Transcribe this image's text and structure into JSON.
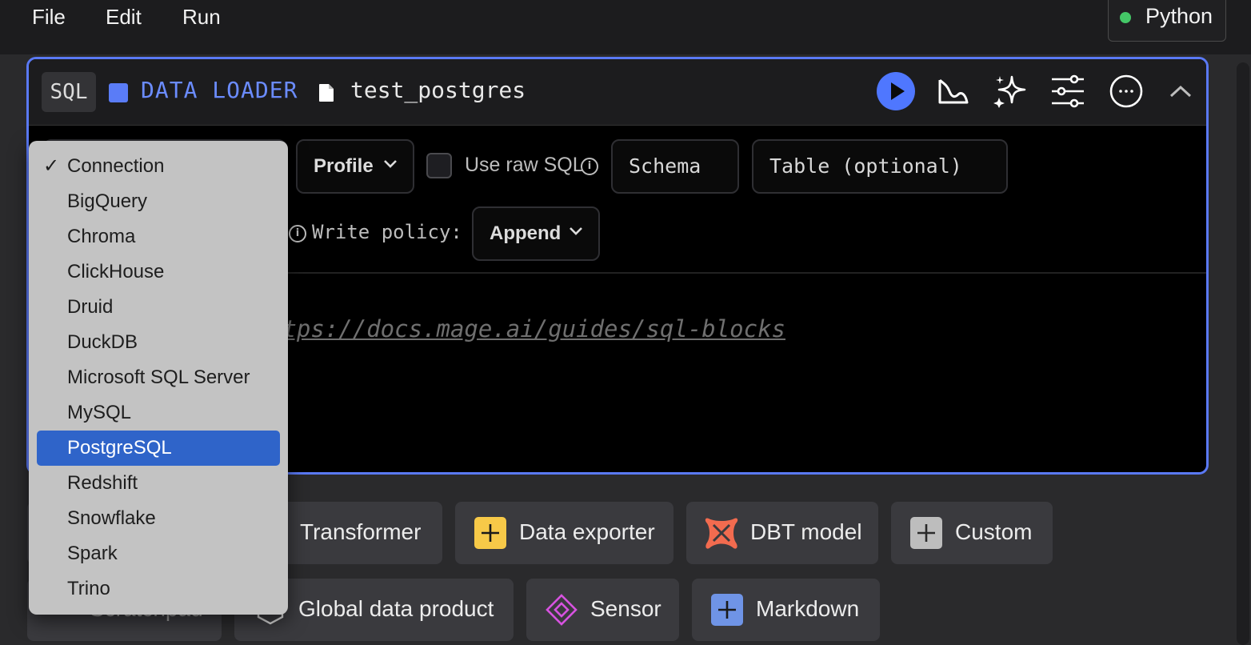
{
  "menu": {
    "items": [
      "File",
      "Edit",
      "Run"
    ]
  },
  "kernel": {
    "label": "Python",
    "status_color": "#44c767"
  },
  "block": {
    "badge": "SQL",
    "type_label": "DATA LOADER",
    "type_color": "#5a7cf7",
    "file_name": "test_postgres",
    "config": {
      "profile_label": "Profile",
      "raw_sql_label": "Use raw SQL",
      "schema_placeholder": "Schema",
      "table_placeholder": "Table (optional)",
      "write_policy_label": "Write policy:",
      "write_policy_value": "Append"
    },
    "editor_comment": "ttps://docs.mage.ai/guides/sql-blocks"
  },
  "header_actions": [
    "run-icon",
    "chart-icon",
    "sparkle-icon",
    "settings-sliders-icon",
    "more-icon",
    "chevron-up-icon"
  ],
  "add_blocks": {
    "row1": [
      "Transformer",
      "Data exporter",
      "DBT model",
      "Custom"
    ],
    "row2": [
      "Scratchpad",
      "Global data product",
      "Sensor",
      "Markdown"
    ]
  },
  "connection_dropdown": {
    "checked": "Connection",
    "options": [
      "Connection",
      "BigQuery",
      "Chroma",
      "ClickHouse",
      "Druid",
      "DuckDB",
      "Microsoft SQL Server",
      "MySQL",
      "PostgreSQL",
      "Redshift",
      "Snowflake",
      "Spark",
      "Trino"
    ],
    "highlighted": "PostgreSQL"
  }
}
